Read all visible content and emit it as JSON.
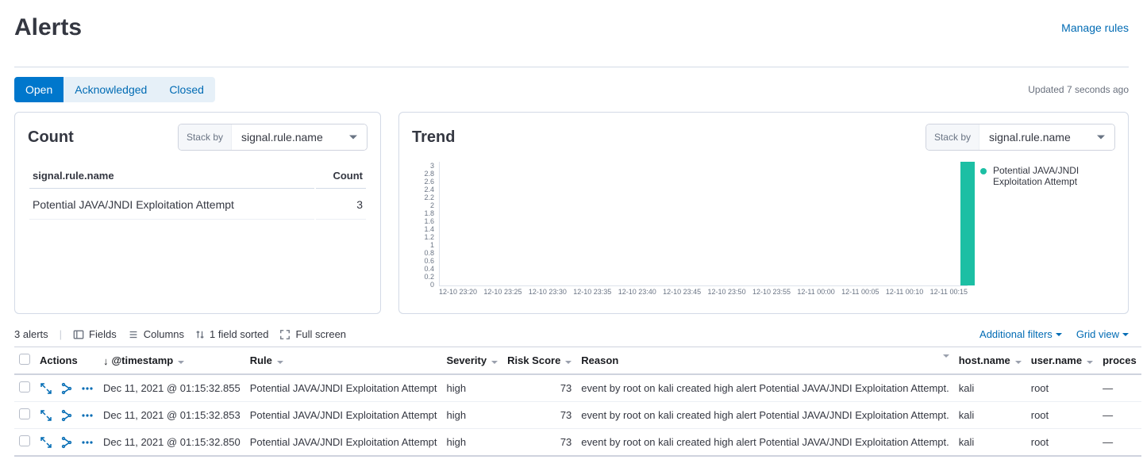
{
  "header": {
    "title": "Alerts",
    "manage_link": "Manage rules"
  },
  "topbar": {
    "tabs": [
      "Open",
      "Acknowledged",
      "Closed"
    ],
    "active_tab": 0,
    "updated_text": "Updated 7 seconds ago"
  },
  "count_panel": {
    "title": "Count",
    "stack_by_label": "Stack by",
    "stack_by_value": "signal.rule.name",
    "col_name": "signal.rule.name",
    "col_count": "Count",
    "rows": [
      {
        "name": "Potential JAVA/JNDI Exploitation Attempt",
        "count": "3"
      }
    ]
  },
  "trend_panel": {
    "title": "Trend",
    "stack_by_label": "Stack by",
    "stack_by_value": "signal.rule.name",
    "legend_label": "Potential JAVA/JNDI Exploitation Attempt"
  },
  "chart_data": {
    "type": "bar",
    "categories": [
      "12-10 23:20",
      "12-10 23:25",
      "12-10 23:30",
      "12-10 23:35",
      "12-10 23:40",
      "12-10 23:45",
      "12-10 23:50",
      "12-10 23:55",
      "12-11 00:00",
      "12-11 00:05",
      "12-11 00:10",
      "12-11 00:15"
    ],
    "y_ticks": [
      "3",
      "2.8",
      "2.6",
      "2.4",
      "2.2",
      "2",
      "1.8",
      "1.6",
      "1.4",
      "1.2",
      "1",
      "0.8",
      "0.6",
      "0.4",
      "0.2",
      "0"
    ],
    "series": [
      {
        "name": "Potential JAVA/JNDI Exploitation Attempt",
        "color": "#1cbfa4",
        "values": [
          0,
          0,
          0,
          0,
          0,
          0,
          0,
          0,
          0,
          0,
          0,
          3
        ]
      }
    ],
    "ylim": [
      0,
      3
    ],
    "xlabel": "",
    "ylabel": ""
  },
  "grid_toolbar": {
    "alerts_count": "3 alerts",
    "fields": "Fields",
    "columns": "Columns",
    "sorted": "1 field sorted",
    "fullscreen": "Full screen",
    "additional_filters": "Additional filters",
    "grid_view": "Grid view"
  },
  "grid": {
    "headers": {
      "actions": "Actions",
      "timestamp": "@timestamp",
      "rule": "Rule",
      "severity": "Severity",
      "risk_score": "Risk Score",
      "reason": "Reason",
      "host_name": "host.name",
      "user_name": "user.name",
      "process": "proces"
    },
    "rows": [
      {
        "timestamp": "Dec 11, 2021 @ 01:15:32.855",
        "rule": "Potential JAVA/JNDI Exploitation Attempt",
        "severity": "high",
        "risk": "73",
        "reason": "event by root on kali created high alert Potential JAVA/JNDI Exploitation Attempt.",
        "host": "kali",
        "user": "root",
        "process": "—"
      },
      {
        "timestamp": "Dec 11, 2021 @ 01:15:32.853",
        "rule": "Potential JAVA/JNDI Exploitation Attempt",
        "severity": "high",
        "risk": "73",
        "reason": "event by root on kali created high alert Potential JAVA/JNDI Exploitation Attempt.",
        "host": "kali",
        "user": "root",
        "process": "—"
      },
      {
        "timestamp": "Dec 11, 2021 @ 01:15:32.850",
        "rule": "Potential JAVA/JNDI Exploitation Attempt",
        "severity": "high",
        "risk": "73",
        "reason": "event by root on kali created high alert Potential JAVA/JNDI Exploitation Attempt.",
        "host": "kali",
        "user": "root",
        "process": "—"
      }
    ]
  }
}
